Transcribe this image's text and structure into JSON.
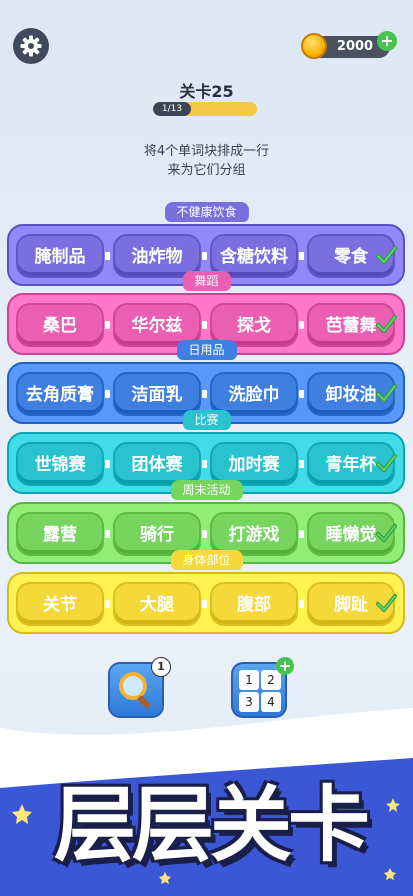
{
  "header": {
    "settings_icon": "gear-icon",
    "coins": "2000",
    "coin_icon": "gold-coin-icon",
    "add_coins_label": "+"
  },
  "level": {
    "title": "关卡25",
    "progress_text": "1/13",
    "progress_fraction": 0.077
  },
  "instruction": {
    "line1": "将4个单词块排成一行",
    "line2": "来为它们分组"
  },
  "categories": [
    {
      "name": "不健康饮食",
      "words": [
        "腌制品",
        "油炸物",
        "含糖饮料",
        "零食"
      ],
      "color": "#7b6fe0",
      "solved": true
    },
    {
      "name": "舞蹈",
      "words": [
        "桑巴",
        "华尔兹",
        "探戈",
        "芭蕾舞"
      ],
      "color": "#ea5fb2",
      "solved": true
    },
    {
      "name": "日用品",
      "words": [
        "去角质膏",
        "洁面乳",
        "洗脸巾",
        "卸妆油"
      ],
      "color": "#3f7fe0",
      "solved": true
    },
    {
      "name": "比赛",
      "words": [
        "世锦赛",
        "团体赛",
        "加时赛",
        "青年杯"
      ],
      "color": "#28c3cf",
      "solved": true
    },
    {
      "name": "周末活动",
      "words": [
        "露营",
        "骑行",
        "打游戏",
        "睡懒觉"
      ],
      "color": "#77d45e",
      "solved": true
    },
    {
      "name": "身体部位",
      "words": [
        "关节",
        "大腿",
        "腹部",
        "脚趾"
      ],
      "color": "#f5d93a",
      "solved": true
    }
  ],
  "tools": {
    "hint_icon": "magnifier-icon",
    "hint_count": "1",
    "shuffle_icon": "number-tiles-icon",
    "shuffle_digits": [
      "1",
      "2",
      "3",
      "4"
    ],
    "shuffle_add": "+"
  },
  "banner": {
    "title": "层层关卡"
  }
}
